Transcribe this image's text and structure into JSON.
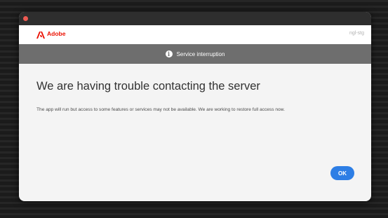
{
  "header": {
    "brand_name": "Adobe",
    "env_label": "ngl-stg",
    "logo_icon": "adobe-logo-icon",
    "brand_color": "#eb1000"
  },
  "banner": {
    "icon": "info-icon",
    "icon_glyph": "i",
    "text": "Service interruption"
  },
  "main": {
    "title": "We are having trouble contacting the server",
    "message": "The app will run but access to some features or services may not be available. We are working to restore full access now."
  },
  "actions": {
    "ok_label": "OK",
    "accent_color": "#2d7ee5"
  }
}
